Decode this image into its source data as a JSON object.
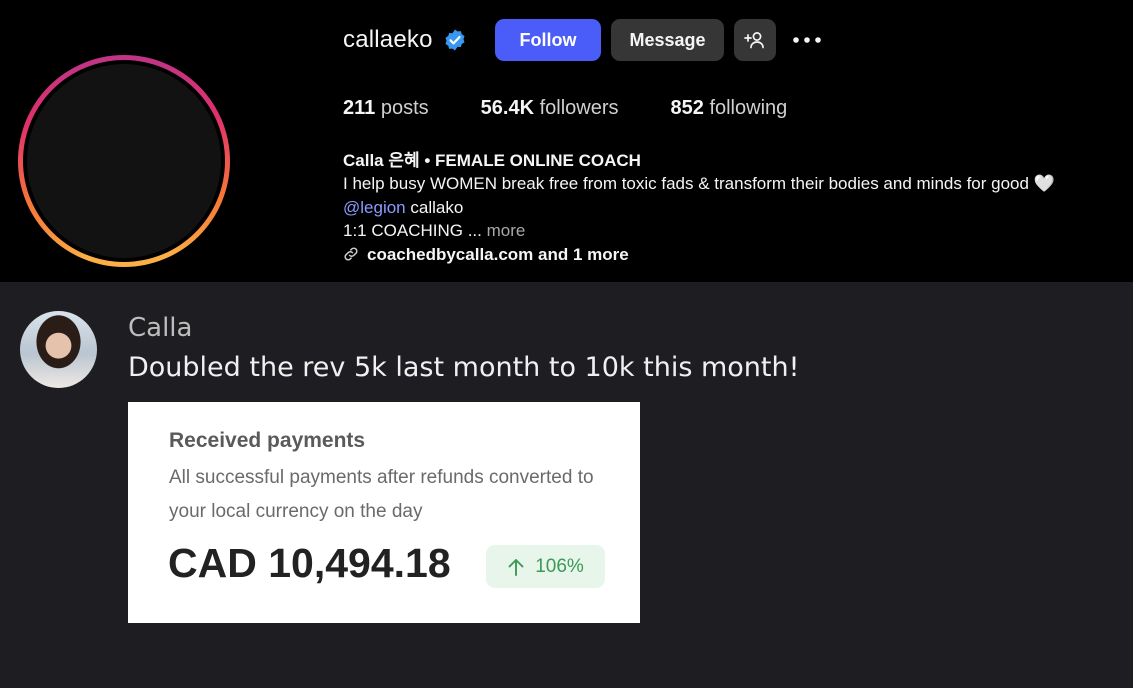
{
  "profile": {
    "username": "callaeko",
    "verified": true,
    "follow_label": "Follow",
    "message_label": "Message",
    "stats": {
      "posts_count": "211",
      "posts_label": "posts",
      "followers_count": "56.4K",
      "followers_label": "followers",
      "following_count": "852",
      "following_label": "following"
    },
    "bio": {
      "name_line": "Calla 은혜 • FEMALE ONLINE COACH",
      "line1": "I help busy WOMEN break free from toxic fads & transform their bodies and minds for good 🤍",
      "mention": "@legion",
      "mention_suffix": " callako",
      "line3": "1:1 COACHING ...",
      "more": " more",
      "link_text": "coachedbycalla.com and 1 more"
    }
  },
  "post": {
    "author": "Calla",
    "text": "Doubled the rev 5k last month to 10k this month!",
    "card": {
      "title": "Received payments",
      "description": "All successful payments after refunds converted to your local currency on the day",
      "amount": "CAD 10,494.18",
      "change": "106%"
    }
  },
  "colors": {
    "follow_button": "#4a5df9",
    "mention": "#8a9bff",
    "badge_bg": "#e7f5ea",
    "badge_text": "#3b9a55",
    "post_bg": "#1e1e22"
  },
  "icons": {
    "verified": "verified-badge-icon",
    "add_user": "add-user-icon",
    "more": "more-dots-icon",
    "link": "link-icon",
    "arrow_up": "arrow-up-icon"
  }
}
